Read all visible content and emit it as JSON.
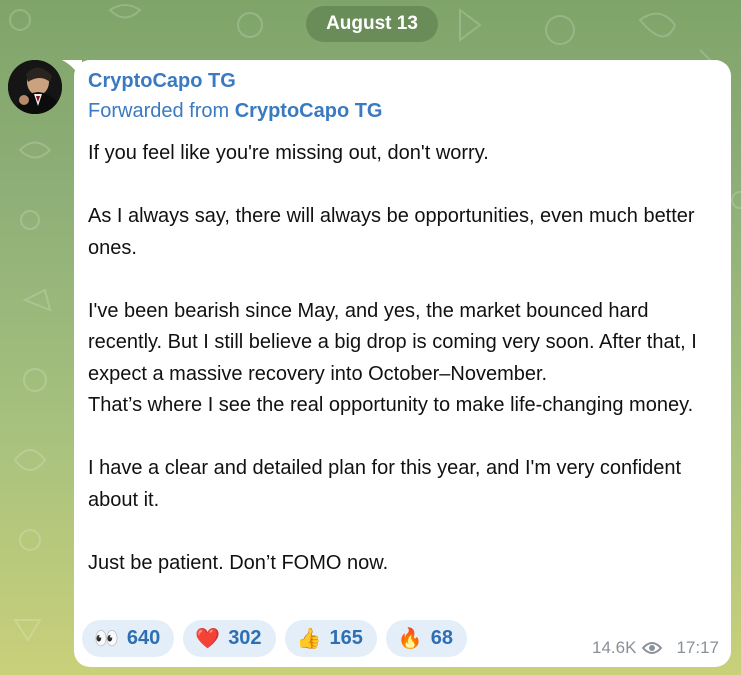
{
  "date_label": "August 13",
  "message": {
    "sender": "CryptoCapo TG",
    "forwarded_prefix": "Forwarded from ",
    "forwarded_from": "CryptoCapo TG",
    "paragraphs": [
      "If you feel like you're missing out, don't worry.",
      "As I always say, there will always be opportunities, even much better ones.",
      "I've been bearish since May, and yes, the market bounced hard recently. But I still believe a big drop is coming very soon. After that, I expect a massive recovery into October–November.",
      "That’s where I see the real opportunity to make life-changing money.",
      "I have a clear and detailed plan for this year, and I'm very confident about it.",
      "Just be patient. Don’t FOMO now."
    ],
    "reactions": [
      {
        "emoji": "👀",
        "icon": "eyes-icon",
        "count": "640"
      },
      {
        "emoji": "❤️",
        "icon": "heart-icon",
        "count": "302"
      },
      {
        "emoji": "👍",
        "icon": "thumbs-up-icon",
        "count": "165"
      },
      {
        "emoji": "🔥",
        "icon": "fire-icon",
        "count": "68"
      }
    ],
    "views": "14.6K",
    "time": "17:17"
  },
  "colors": {
    "accent": "#3a7ac0",
    "reaction_bg": "#e4eef8",
    "date_pill_bg": "#5f8250"
  }
}
